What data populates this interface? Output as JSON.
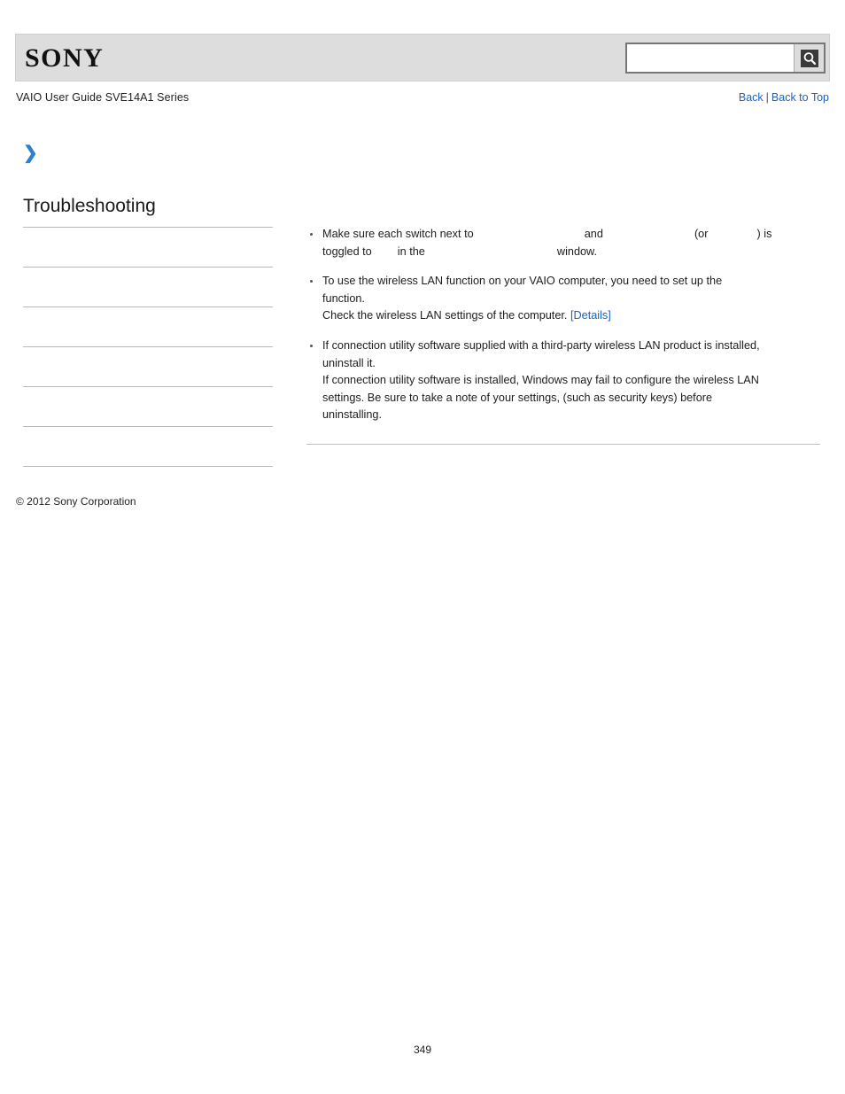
{
  "header": {
    "logo_text": "SONY",
    "search": {
      "value": "",
      "placeholder": "",
      "button_icon": "search-icon"
    }
  },
  "subheader": {
    "guide_title": "VAIO User Guide SVE14A1 Series",
    "back_label": "Back",
    "separator": "|",
    "back_to_top_label": "Back to Top"
  },
  "sidebar": {
    "section_title": "Troubleshooting",
    "items": [
      {
        "label": ""
      },
      {
        "label": ""
      },
      {
        "label": ""
      },
      {
        "label": ""
      },
      {
        "label": ""
      },
      {
        "label": ""
      }
    ]
  },
  "content": {
    "bullets": [
      {
        "id": "bullet-switches",
        "line1_a": "Make sure each switch next to",
        "line1_b": "and",
        "line1_c": "(or",
        "line1_d": ") is",
        "line2_a": "toggled to",
        "line2_b": "in the",
        "line2_c": "window."
      },
      {
        "id": "bullet-wireless-lan-setup",
        "line1": "To use the wireless LAN function on your VAIO computer, you need to set up the",
        "line2": "function.",
        "line3": "Check the wireless LAN settings of the computer.",
        "link_label": "[Details]"
      },
      {
        "id": "bullet-third-party-utility",
        "line1": "If connection utility software supplied with a third-party wireless LAN product is installed,",
        "line2": "uninstall it.",
        "line3": "If connection utility software is installed, Windows may fail to configure the wireless LAN",
        "line4": "settings. Be sure to take a note of your settings, (such as security keys) before",
        "line5": "uninstalling."
      }
    ]
  },
  "footer": {
    "copyright": "© 2012 Sony Corporation",
    "page_number": "349"
  }
}
